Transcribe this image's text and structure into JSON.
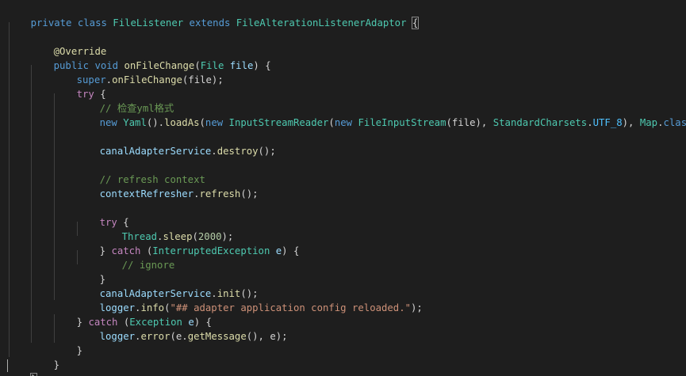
{
  "code": {
    "l1": {
      "kw1": "private",
      "kw2": "class",
      "cls": "FileListener",
      "kw3": "extends",
      "parent": "FileAlterationListenerAdaptor",
      "brace": "{"
    },
    "l3": {
      "at": "@",
      "ann": "Override"
    },
    "l4": {
      "kw1": "public",
      "kw2": "void",
      "fn": "onFileChange",
      "p1": "(",
      "type": "File",
      "param": "file",
      "p2": ") {"
    },
    "l5": {
      "kw": "super",
      "dot": ".",
      "fn": "onFileChange",
      "rest": "(file);"
    },
    "l6": {
      "kw": "try",
      "rest": " {"
    },
    "l7": {
      "cmt": "// 检查yml格式"
    },
    "l8": {
      "kw1": "new",
      "type1": "Yaml",
      "p1": "().",
      "fn1": "loadAs",
      "p2": "(",
      "kw2": "new",
      "type2": "InputStreamReader",
      "p3": "(",
      "kw3": "new",
      "type3": "FileInputStream",
      "p4": "(file), ",
      "type4": "StandardCharsets",
      "dot1": ".",
      "const": "UTF_8",
      "p5": "), ",
      "type5": "Map",
      "dot2": ".",
      "kw4": "class",
      "p6": ");"
    },
    "l10": {
      "var": "canalAdapterService",
      "dot": ".",
      "fn": "destroy",
      "rest": "();"
    },
    "l12": {
      "cmt": "// refresh context"
    },
    "l13": {
      "var": "contextRefresher",
      "dot": ".",
      "fn": "refresh",
      "rest": "();"
    },
    "l15": {
      "kw": "try",
      "rest": " {"
    },
    "l16": {
      "type": "Thread",
      "dot": ".",
      "fn": "sleep",
      "p1": "(",
      "num": "2000",
      "p2": ");"
    },
    "l17": {
      "p1": "} ",
      "kw": "catch",
      "p2": " (",
      "type": "InterruptedException",
      "param": "e",
      "p3": ") {"
    },
    "l18": {
      "cmt": "// ignore"
    },
    "l19": {
      "p": "}"
    },
    "l20": {
      "var": "canalAdapterService",
      "dot": ".",
      "fn": "init",
      "rest": "();"
    },
    "l21": {
      "var": "logger",
      "dot": ".",
      "fn": "info",
      "p1": "(",
      "str": "\"## adapter application config reloaded.\"",
      "p2": ");"
    },
    "l22": {
      "p1": "} ",
      "kw": "catch",
      "p2": " (",
      "type": "Exception",
      "param": "e",
      "p3": ") {"
    },
    "l23": {
      "var": "logger",
      "dot": ".",
      "fn": "error",
      "p1": "(e.",
      "fn2": "getMessage",
      "p2": "(), e);"
    },
    "l24": {
      "p": "}"
    },
    "l25": {
      "p": "}"
    },
    "l26": {
      "p": "}"
    }
  },
  "colors": {
    "background": "#1e1e1e",
    "keyword": "#569cd6",
    "control": "#c586c0",
    "type": "#4ec9b0",
    "function": "#dcdcaa",
    "variable": "#9cdcfe",
    "string": "#ce9178",
    "number": "#b5cea8",
    "comment": "#6a9955"
  }
}
